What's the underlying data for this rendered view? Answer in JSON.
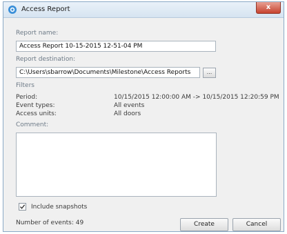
{
  "window": {
    "title": "Access Report",
    "close_glyph": "x"
  },
  "form": {
    "report_name_label": "Report name:",
    "report_name_value": "Access Report 10-15-2015 12-51-04 PM",
    "report_destination_label": "Report destination:",
    "report_destination_value": "C:\\Users\\sbarrow\\Documents\\Milestone\\Access Reports",
    "browse_label": "..."
  },
  "filters": {
    "heading": "Filters",
    "period_label": "Period:",
    "period_value": "10/15/2015 12:00:00 AM -> 10/15/2015 12:20:59 PM",
    "event_types_label": "Event types:",
    "event_types_value": "All events",
    "access_units_label": "Access units:",
    "access_units_value": "All doors"
  },
  "comment": {
    "label": "Comment:",
    "value": ""
  },
  "snapshots": {
    "label": "Include snapshots",
    "checked": true
  },
  "footer": {
    "events_count": "Number of events: 49",
    "create_label": "Create",
    "cancel_label": "Cancel"
  },
  "colors": {
    "title_bar": "#dbe7f3",
    "close_button": "#c7432f",
    "label_text": "#6d7a87"
  },
  "icons": {
    "app": "milestone-logo-icon",
    "check": "checkmark-icon",
    "close": "close-icon"
  }
}
